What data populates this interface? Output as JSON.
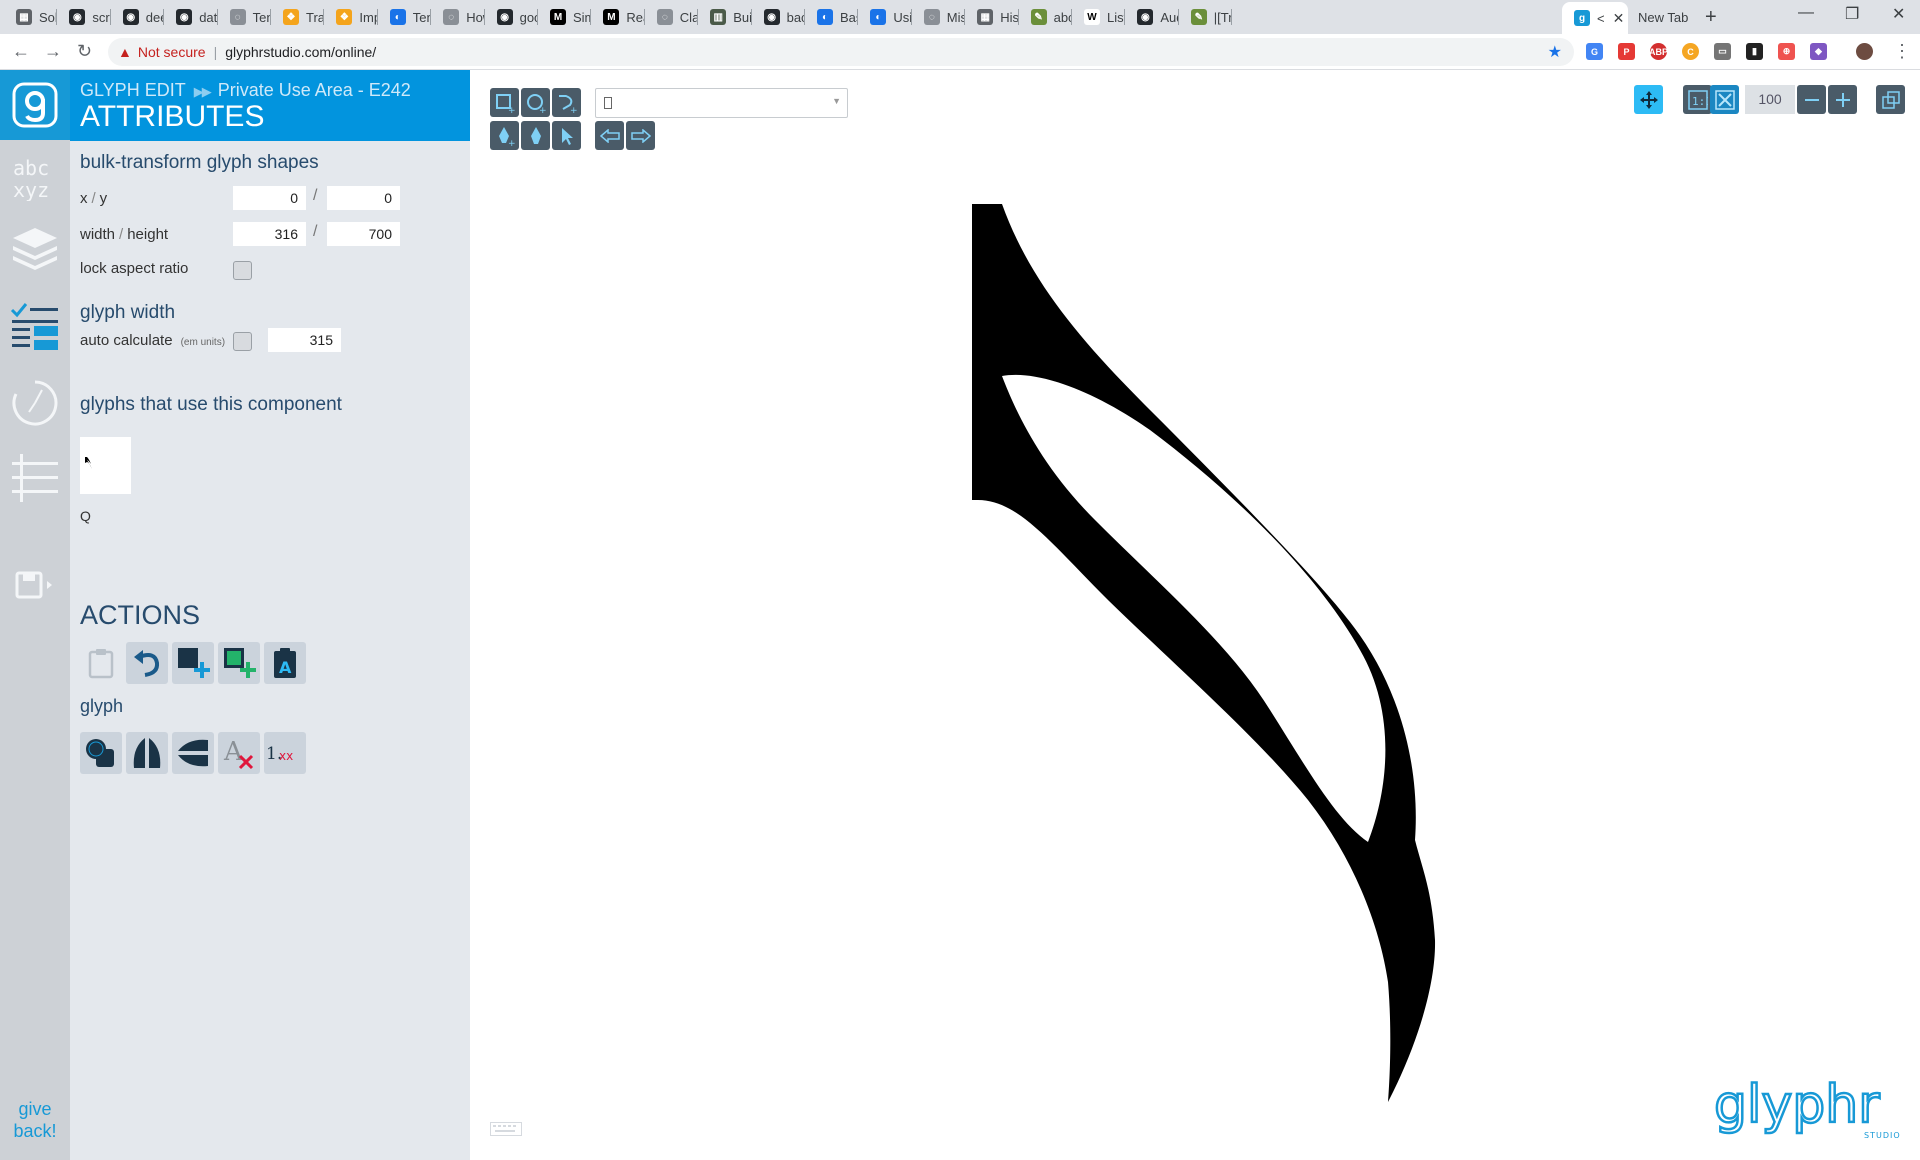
{
  "browser": {
    "tabs": [
      {
        "label": "Solid",
        "fav": "S"
      },
      {
        "label": "scrap",
        "fav": "gh"
      },
      {
        "label": "deep",
        "fav": "gh"
      },
      {
        "label": "data-",
        "fav": "gh"
      },
      {
        "label": "Tens",
        "fav": "s"
      },
      {
        "label": "Trans",
        "fav": "t"
      },
      {
        "label": "Impo",
        "fav": "t"
      },
      {
        "label": "Tens",
        "fav": "c"
      },
      {
        "label": "How",
        "fav": "s"
      },
      {
        "label": "goog",
        "fav": "gh"
      },
      {
        "label": "Simp",
        "fav": "M"
      },
      {
        "label": "Realt",
        "fav": "M"
      },
      {
        "label": "Class",
        "fav": "s"
      },
      {
        "label": "Build",
        "fav": "b"
      },
      {
        "label": "bacti",
        "fav": "gh"
      },
      {
        "label": "Basic",
        "fav": "c"
      },
      {
        "label": "Using",
        "fav": "c"
      },
      {
        "label": "Misc",
        "fav": "s"
      },
      {
        "label": "Histo",
        "fav": "S"
      },
      {
        "label": "abcs",
        "fav": "a"
      },
      {
        "label": "List o",
        "fav": "W"
      },
      {
        "label": "Audi",
        "fav": "gh"
      },
      {
        "label": "|[Trac",
        "fav": "a"
      }
    ],
    "active_tab_label": "<",
    "newtab_label": "New Tab",
    "not_secure": "Not secure",
    "url": "glyphrstudio.com/online/"
  },
  "panel": {
    "breadcrumb_section": "GLYPH EDIT",
    "breadcrumb_item": "Private Use Area - E242",
    "title": "ATTRIBUTES",
    "bulk_title": "bulk-transform glyph shapes",
    "xy_label_x": "x",
    "xy_label_y": "y",
    "x_value": "0",
    "y_value": "0",
    "wh_label_w": "width",
    "wh_label_h": "height",
    "width_value": "316",
    "height_value": "700",
    "lock_aspect_label": "lock aspect ratio",
    "glyph_width_title": "glyph width",
    "auto_calc_label": "auto calculate",
    "em_units_label": "(em units)",
    "glyph_width_value": "315",
    "component_users_title": "glyphs that use this component",
    "component_user_label": "Q",
    "actions_title": "ACTIONS",
    "glyph_actions_title": "glyph",
    "give_back": "give back!"
  },
  "canvas": {
    "zoom": "100",
    "logo_text": "glyphr",
    "logo_subtext": "STUDIO"
  },
  "colors": {
    "brand_blue": "#0294de",
    "tool_dark": "#4a5b68",
    "highlight_blue": "#2dbbf5"
  }
}
